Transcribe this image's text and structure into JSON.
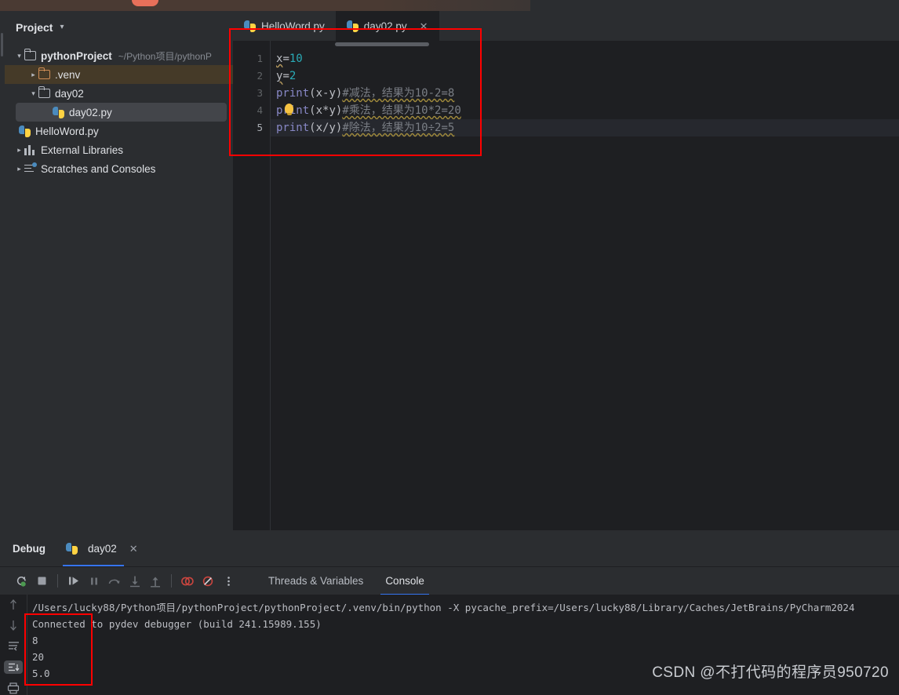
{
  "window": {
    "title_bar_visible": true
  },
  "sidebar": {
    "header": "Project",
    "header_caret": "chevron-down",
    "tree": [
      {
        "label": "pythonProject",
        "path": "~/Python项目/pythonP",
        "icon": "folder",
        "depth": 0,
        "arrow": "⌄",
        "bold": true,
        "state": "normal"
      },
      {
        "label": ".venv",
        "path": "",
        "icon": "folder-orange",
        "depth": 1,
        "arrow": "›",
        "bold": false,
        "state": "highlighted"
      },
      {
        "label": "day02",
        "path": "",
        "icon": "folder",
        "depth": 1,
        "arrow": "⌄",
        "bold": false,
        "state": "normal"
      },
      {
        "label": "day02.py",
        "path": "",
        "icon": "python-file",
        "depth": 2,
        "arrow": "",
        "bold": false,
        "state": "selected"
      },
      {
        "label": "HelloWord.py",
        "path": "",
        "icon": "python-file",
        "depth": 2,
        "arrow": "",
        "bold": false,
        "state": "normal"
      },
      {
        "label": "External Libraries",
        "path": "",
        "icon": "library",
        "depth": 0,
        "arrow": "›",
        "bold": false,
        "state": "normal"
      },
      {
        "label": "Scratches and Consoles",
        "path": "",
        "icon": "scratches",
        "depth": 0,
        "arrow": "›",
        "bold": false,
        "state": "normal"
      }
    ]
  },
  "editor": {
    "tabs": [
      {
        "label": "HelloWord.py",
        "icon": "python-file",
        "active": false,
        "closable": false
      },
      {
        "label": "day02.py",
        "icon": "python-file",
        "active": true,
        "closable": true,
        "close_glyph": "✕"
      }
    ],
    "line_numbers": [
      "1",
      "2",
      "3",
      "4",
      "5"
    ],
    "current_line": 5,
    "lines": [
      {
        "n": "1",
        "var": "x",
        "op": "=",
        "num": "10",
        "kind": "assign"
      },
      {
        "n": "2",
        "var": "y",
        "op": "=",
        "num": "2",
        "kind": "assign"
      },
      {
        "n": "3",
        "fn": "print",
        "args": "(x-y)",
        "comment": "#减法，结果为10-2=8",
        "kind": "call"
      },
      {
        "n": "4",
        "fn": "print",
        "args": "(x*y)",
        "comment": "#乘法，结果为10*2=20",
        "kind": "call",
        "has_bulb": true
      },
      {
        "n": "5",
        "fn": "print",
        "args": "(x/y)",
        "comment": "#除法，结果为10÷2=5",
        "kind": "call"
      }
    ],
    "annotation_box_color": "#ff0000",
    "right_marker_color": "#ff0000"
  },
  "debug": {
    "title": "Debug",
    "session_tab": "day02",
    "session_close_glyph": "✕",
    "toolbar": [
      {
        "name": "rerun-icon"
      },
      {
        "name": "stop-icon"
      },
      {
        "name": "resume-icon"
      },
      {
        "name": "pause-icon"
      },
      {
        "name": "step-over-icon"
      },
      {
        "name": "step-into-icon"
      },
      {
        "name": "step-out-icon"
      },
      {
        "name": "view-breakpoints-icon"
      },
      {
        "name": "mute-breakpoints-icon"
      },
      {
        "name": "more-options-icon"
      }
    ],
    "tabs": [
      {
        "label": "Threads & Variables",
        "active": false
      },
      {
        "label": "Console",
        "active": true
      }
    ],
    "rail_buttons": [
      {
        "name": "scroll-up-icon"
      },
      {
        "name": "scroll-down-icon"
      },
      {
        "name": "soft-wrap-icon"
      },
      {
        "name": "scroll-to-end-icon"
      },
      {
        "name": "print-icon"
      }
    ],
    "console_lines": [
      "/Users/lucky88/Python项目/pythonProject/pythonProject/.venv/bin/python -X pycache_prefix=/Users/lucky88/Library/Caches/JetBrains/PyCharm2024",
      "Connected to pydev debugger (build 241.15989.155)",
      "8",
      "20",
      "5.0"
    ]
  },
  "watermark": {
    "text": "CSDN @不打代码的程序员950720"
  },
  "colors": {
    "accent_blue": "#3574f0",
    "annotation_red": "#ff0000",
    "number_token": "#2aacb8",
    "function_token": "#8888c6",
    "comment_token": "#7a7e85",
    "panel_bg": "#2b2d30",
    "editor_bg": "#1e1f22"
  }
}
